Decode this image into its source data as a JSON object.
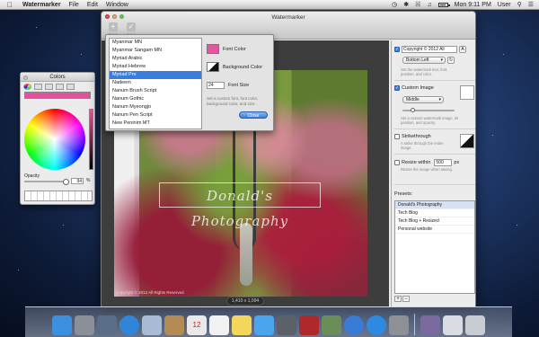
{
  "menubar": {
    "apple_glyph": "",
    "app_name": "Watermarker",
    "menus": [
      "File",
      "Edit",
      "Window"
    ],
    "clock": "Mon 9:11 PM",
    "user": "User"
  },
  "colors_panel": {
    "title": "Colors",
    "opacity_label": "Opacity",
    "opacity_value": "94",
    "opacity_unit": "%",
    "current_color": "#e4519d",
    "opacity_level": 0.94
  },
  "window": {
    "title": "Watermarker",
    "toolbar": {
      "open_label": "Open",
      "save_label": "Save"
    },
    "watermark_text": "Donald's Photography",
    "photo_copyright": "Copyright © 2012 All Rights Reserved",
    "dimensions": "1,410 x 1,094"
  },
  "font_panel": {
    "fonts": [
      "Myanmar MN",
      "Myanmar Sangam MN",
      "Myriad Arabic",
      "Myriad Hebrew",
      "Myriad Pro",
      "Nadeem",
      "Nanum Brush Script",
      "Nanum Gothic",
      "Nanum Myeongjo",
      "Nanum Pen Script",
      "New Peninim MT"
    ],
    "selected_font": "Myriad Pro",
    "font_color_label": "Font Color",
    "font_color": "#e2579f",
    "background_color_label": "Background Color",
    "size_value": "24",
    "size_label": "Font Size",
    "help": "Set a custom font, font color, background color, and size.",
    "close_label": "Close"
  },
  "inspector": {
    "copyright": {
      "checked": true,
      "field_value": "Copyright © 2012 All",
      "field_end": "A",
      "position": "Bottom Left",
      "help": "Set the watermark text, font, position, and color."
    },
    "custom_image": {
      "checked": true,
      "label": "Custom Image",
      "position": "Middle",
      "help": "Set a custom watermark image, its position, and opacity.",
      "opacity_level": 0.2
    },
    "strikethrough": {
      "checked": false,
      "label": "Strikethrough",
      "help": "A strike through the entire image."
    },
    "resize": {
      "checked": false,
      "label": "Resize within",
      "value": "500",
      "unit": "px",
      "help": "Resize the image when saving."
    },
    "presets_label": "Presets:",
    "presets": [
      "Donald's Photography",
      "Tech Blog",
      "Tech Blog + Resized",
      "Personal website"
    ],
    "selected_preset": "Donald's Photography",
    "add_label": "+",
    "remove_label": "−"
  },
  "dock": {
    "items": [
      {
        "name": "finder-icon",
        "color": "#3d8fe0"
      },
      {
        "name": "launchpad-icon",
        "color": "#8a8f98"
      },
      {
        "name": "mission-control-icon",
        "color": "#5a6e8a"
      },
      {
        "name": "safari-icon",
        "color": "#2f86d8"
      },
      {
        "name": "mail-icon",
        "color": "#a9bcd6"
      },
      {
        "name": "contacts-icon",
        "color": "#b48a55"
      },
      {
        "name": "calendar-icon",
        "color": "#e9e9e9"
      },
      {
        "name": "reminders-icon",
        "color": "#f2f2f2"
      },
      {
        "name": "notes-icon",
        "color": "#f3d65a"
      },
      {
        "name": "messages-icon",
        "color": "#4aa4ee"
      },
      {
        "name": "facetime-icon",
        "color": "#5b6168"
      },
      {
        "name": "photo-booth-icon",
        "color": "#b0282c"
      },
      {
        "name": "iphoto-icon",
        "color": "#6b8d5a"
      },
      {
        "name": "itunes-icon",
        "color": "#3a7cd5"
      },
      {
        "name": "app-store-icon",
        "color": "#2c8ae3"
      },
      {
        "name": "system-preferences-icon",
        "color": "#8d9095"
      },
      {
        "name": "watermarker-icon",
        "color": "#7a6a9e"
      },
      {
        "name": "documents-icon",
        "color": "#d9dde3"
      },
      {
        "name": "trash-icon",
        "color": "#c9cdd3"
      }
    ],
    "calendar_day": "12"
  }
}
